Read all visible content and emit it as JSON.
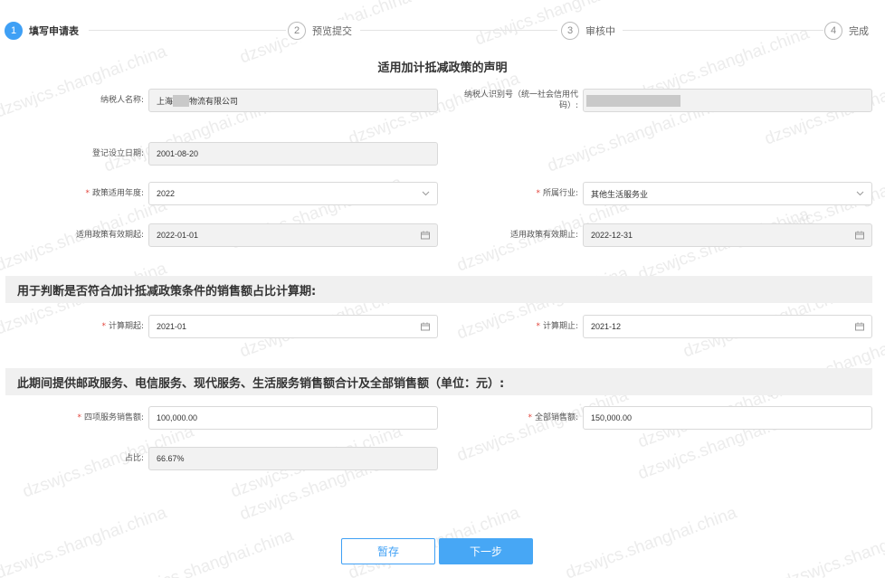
{
  "watermark": "dzswjcs.shanghai.china",
  "steps": [
    {
      "num": "1",
      "label": "填写申请表"
    },
    {
      "num": "2",
      "label": "预览提交"
    },
    {
      "num": "3",
      "label": "审核中"
    },
    {
      "num": "4",
      "label": "完成"
    }
  ],
  "form_title": "适用加计抵减政策的声明",
  "fields": {
    "taxpayer_name": {
      "label": "纳税人名称:",
      "value_prefix": "上海",
      "value_suffix": "物流有限公司"
    },
    "taxpayer_id": {
      "label_line1": "纳税人识别号（统一社会信用代",
      "label_line2": "码）:"
    },
    "reg_date": {
      "label": "登记设立日期:",
      "value": "2001-08-20"
    },
    "policy_year": {
      "label": "政策适用年度:",
      "value": "2022"
    },
    "industry": {
      "label": "所属行业:",
      "value": "其他生活服务业"
    },
    "valid_start": {
      "label": "适用政策有效期起:",
      "value": "2022-01-01"
    },
    "valid_end": {
      "label": "适用政策有效期止:",
      "value": "2022-12-31"
    },
    "calc_start": {
      "label": "计算期起:",
      "value": "2021-01"
    },
    "calc_end": {
      "label": "计算期止:",
      "value": "2021-12"
    },
    "four_services_sales": {
      "label": "四项服务销售额:",
      "value": "100,000.00"
    },
    "total_sales": {
      "label": "全部销售额:",
      "value": "150,000.00"
    },
    "ratio": {
      "label": "占比:",
      "value": "66.67%"
    }
  },
  "sections": {
    "period": "用于判断是否符合加计抵减政策条件的销售额占比计算期:",
    "sales": "此期间提供邮政服务、电信服务、现代服务、生活服务销售额合计及全部销售额（单位：元）:"
  },
  "buttons": {
    "save": "暂存",
    "next": "下一步"
  },
  "required_mark": "*"
}
